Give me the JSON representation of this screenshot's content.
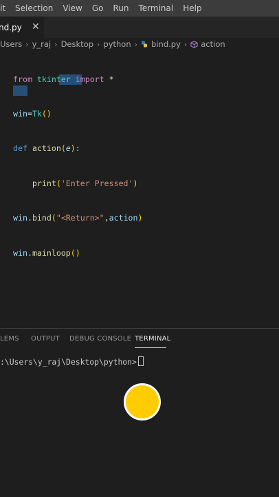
{
  "menu": [
    "it",
    "Selection",
    "View",
    "Go",
    "Run",
    "Terminal",
    "Help"
  ],
  "tab": {
    "label": "nd.py",
    "close_glyph": "✕"
  },
  "breadcrumb": {
    "items": [
      "Users",
      "y_raj",
      "Desktop",
      "python",
      "bind.py",
      "action"
    ],
    "separator": "›"
  },
  "code": {
    "lines": [
      "from tkinter import *",
      "win=Tk()",
      "def action(e):",
      "    print('Enter Pressed')",
      "win.bind(\"<Return>\",action)",
      "win.mainloop()"
    ]
  },
  "panel": {
    "tabs": [
      "LEMS",
      "OUTPUT",
      "DEBUG CONSOLE",
      "TERMINAL"
    ],
    "active_tab": "TERMINAL"
  },
  "terminal": {
    "prompt": ":\\Users\\y_raj\\Desktop\\python>"
  },
  "colors": {
    "accent": "#ffcc00",
    "background": "#1e1e1e",
    "menubar": "#3c3c3c"
  }
}
